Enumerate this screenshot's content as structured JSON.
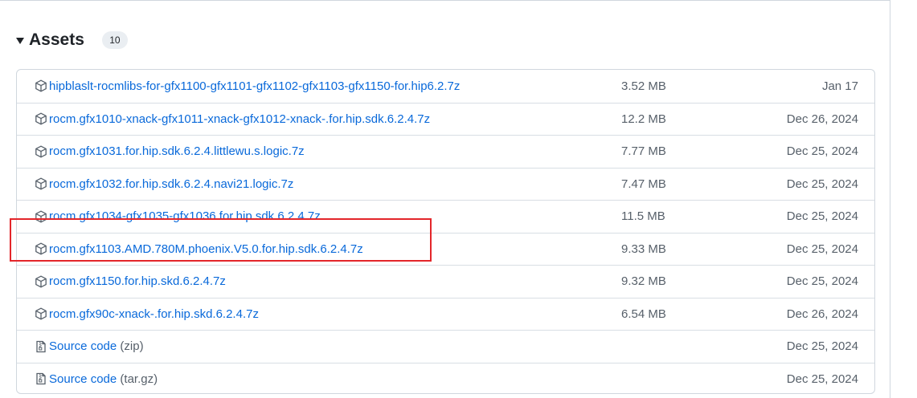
{
  "header": {
    "title": "Assets",
    "count": "10"
  },
  "assets": [
    {
      "name": "hipblaslt-rocmlibs-for-gfx1100-gfx1101-gfx1102-gfx1103-gfx1150-for.hip6.2.7z",
      "suffix": "",
      "size": "3.52 MB",
      "date": "Jan 17",
      "icon": "package-icon"
    },
    {
      "name": "rocm.gfx1010-xnack-gfx1011-xnack-gfx1012-xnack-.for.hip.sdk.6.2.4.7z",
      "suffix": "",
      "size": "12.2 MB",
      "date": "Dec 26, 2024",
      "icon": "package-icon"
    },
    {
      "name": "rocm.gfx1031.for.hip.sdk.6.2.4.littlewu.s.logic.7z",
      "suffix": "",
      "size": "7.77 MB",
      "date": "Dec 25, 2024",
      "icon": "package-icon"
    },
    {
      "name": "rocm.gfx1032.for.hip.sdk.6.2.4.navi21.logic.7z",
      "suffix": "",
      "size": "7.47 MB",
      "date": "Dec 25, 2024",
      "icon": "package-icon"
    },
    {
      "name": "rocm.gfx1034-gfx1035-gfx1036.for.hip.sdk.6.2.4.7z",
      "suffix": "",
      "size": "11.5 MB",
      "date": "Dec 25, 2024",
      "icon": "package-icon"
    },
    {
      "name": "rocm.gfx1103.AMD.780M.phoenix.V5.0.for.hip.sdk.6.2.4.7z",
      "suffix": "",
      "size": "9.33 MB",
      "date": "Dec 25, 2024",
      "icon": "package-icon"
    },
    {
      "name": "rocm.gfx1150.for.hip.skd.6.2.4.7z",
      "suffix": "",
      "size": "9.32 MB",
      "date": "Dec 25, 2024",
      "icon": "package-icon"
    },
    {
      "name": "rocm.gfx90c-xnack-.for.hip.skd.6.2.4.7z",
      "suffix": "",
      "size": "6.54 MB",
      "date": "Dec 26, 2024",
      "icon": "package-icon"
    },
    {
      "name": "Source code",
      "suffix": "(zip)",
      "size": "",
      "date": "Dec 25, 2024",
      "icon": "file-zip-icon"
    },
    {
      "name": "Source code",
      "suffix": "(tar.gz)",
      "size": "",
      "date": "Dec 25, 2024",
      "icon": "file-zip-icon"
    }
  ],
  "colors": {
    "link": "#0969da",
    "highlight": "#e3262a"
  }
}
